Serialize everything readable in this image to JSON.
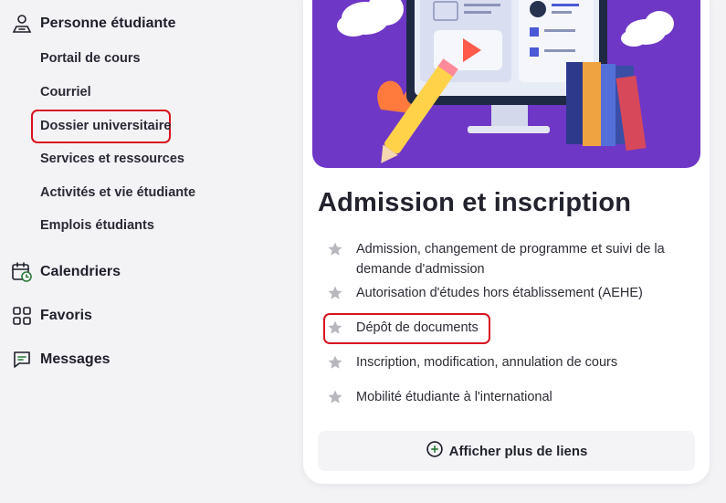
{
  "sidebar": {
    "student_section": {
      "label": "Personne étudiante",
      "icon": "student-person-icon",
      "items": [
        {
          "label": "Portail de cours"
        },
        {
          "label": "Courriel"
        },
        {
          "label": "Dossier universitaire"
        },
        {
          "label": "Services et ressources"
        },
        {
          "label": "Activités et vie étudiante"
        },
        {
          "label": "Emplois étudiants"
        }
      ]
    },
    "sections": [
      {
        "label": "Calendriers",
        "icon": "calendar-icon"
      },
      {
        "label": "Favoris",
        "icon": "grid-icon"
      },
      {
        "label": "Messages",
        "icon": "message-icon"
      }
    ]
  },
  "card": {
    "title": "Admission et inscription",
    "links": [
      {
        "label": "Admission, changement de programme et suivi de la demande d'admission"
      },
      {
        "label": "Autorisation d'études hors établissement (AEHE)"
      },
      {
        "label": "Dépôt de documents"
      },
      {
        "label": "Inscription, modification, annulation de cours"
      },
      {
        "label": "Mobilité étudiante à l'international"
      }
    ],
    "more_button": {
      "label": "Afficher plus de liens",
      "icon": "plus-circle-icon"
    }
  },
  "colors": {
    "accent_green": "#2b7a3a",
    "highlight_red": "#d7141f",
    "hero_purple": "#6f37c6",
    "star_gray": "#b7b7bd"
  }
}
